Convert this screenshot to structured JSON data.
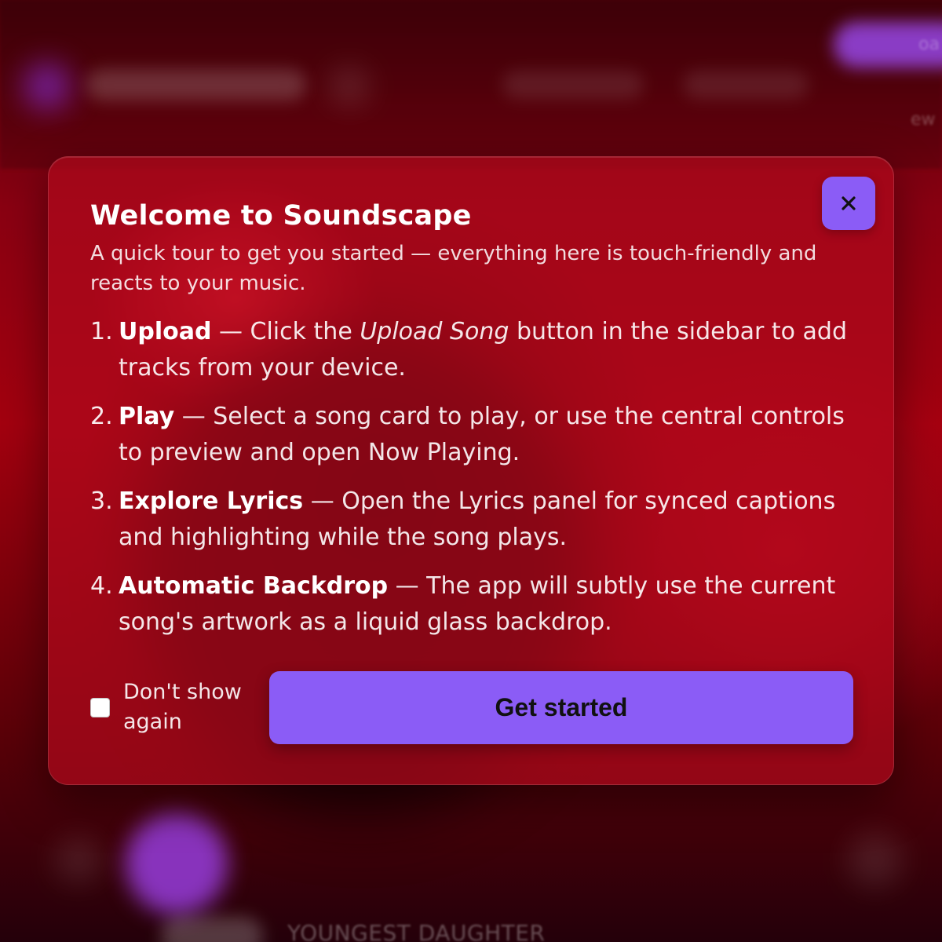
{
  "background": {
    "track_title": "YOUNGEST DAUGHTER",
    "top_right_fragments": [
      "oa",
      "ew"
    ]
  },
  "modal": {
    "title": "Welcome to Soundscape",
    "subtitle": "A quick tour to get you started — everything here is touch-friendly and reacts to your music.",
    "close_icon": "close-icon",
    "steps": [
      {
        "number": "1.",
        "name": "Upload",
        "text_before": " — Click the ",
        "emphasis": "Upload Song",
        "text_after": " button in the sidebar to add tracks from your device."
      },
      {
        "number": "2.",
        "name": "Play",
        "text": " — Select a song card to play, or use the central controls to preview and open Now Playing."
      },
      {
        "number": "3.",
        "name": "Explore Lyrics",
        "text": " — Open the Lyrics panel for synced captions and highlighting while the song plays."
      },
      {
        "number": "4.",
        "name": "Automatic Backdrop",
        "text": " — The app will subtly use the current song's artwork as a liquid glass backdrop."
      }
    ],
    "dont_show_again_label": "Don't show again",
    "dont_show_again_checked": false,
    "primary_button_label": "Get started"
  },
  "colors": {
    "accent": "#8b5cf6",
    "modal_bg": "#af081c",
    "backdrop": "#a3000f"
  }
}
